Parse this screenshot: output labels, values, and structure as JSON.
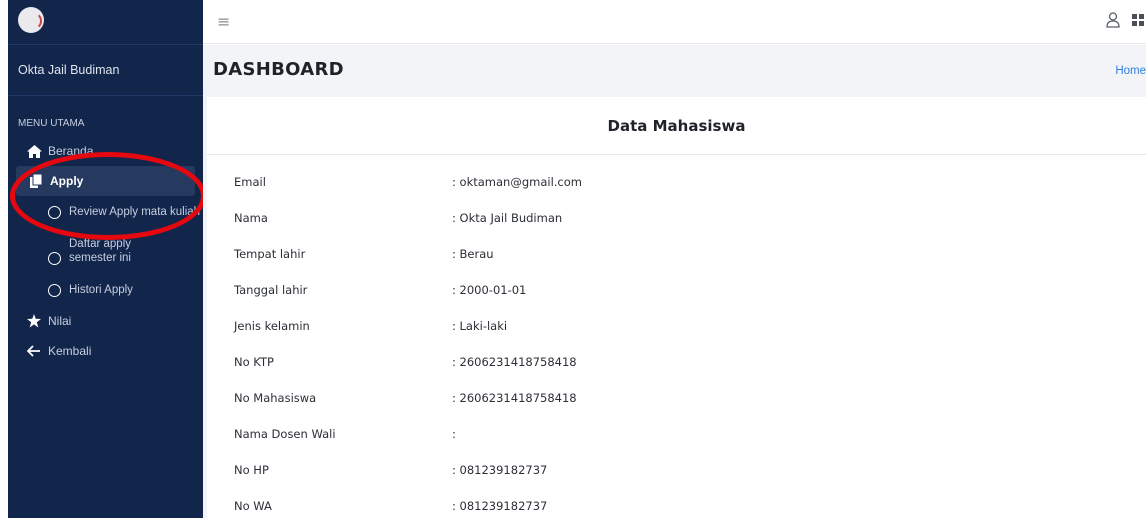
{
  "sidebar": {
    "brand": "",
    "user_name": "Okta Jail Budiman",
    "menu_header": "MENU UTAMA",
    "items": [
      {
        "label": "Beranda",
        "icon": "home-icon"
      },
      {
        "label": "Apply",
        "icon": "copy-icon",
        "active": true
      },
      {
        "label": "Nilai",
        "icon": "star-icon"
      },
      {
        "label": "Kembali",
        "icon": "arrow-left-icon"
      }
    ],
    "sub_items": {
      "review": "Review Apply mata kuliah",
      "daftar_line1": "Daftar apply",
      "daftar_line2": "semester ini",
      "histori": "Histori Apply"
    }
  },
  "topbar": {
    "menu_icon": "hamburger-icon",
    "user_icon": "user-icon",
    "apps_icon": "apps-grid-icon"
  },
  "header": {
    "title": "DASHBOARD",
    "breadcrumb": "Home"
  },
  "card": {
    "title": "Data Mahasiswa",
    "rows": [
      {
        "label": "Email",
        "value": ": oktaman@gmail.com"
      },
      {
        "label": "Nama",
        "value": ": Okta Jail Budiman"
      },
      {
        "label": "Tempat lahir",
        "value": ": Berau"
      },
      {
        "label": "Tanggal lahir",
        "value": ": 2000-01-01"
      },
      {
        "label": "Jenis kelamin",
        "value": ": Laki-laki"
      },
      {
        "label": "No KTP",
        "value": ": 2606231418758418"
      },
      {
        "label": "No Mahasiswa",
        "value": ": 2606231418758418"
      },
      {
        "label": "Nama Dosen Wali",
        "value": ":"
      },
      {
        "label": "No HP",
        "value": ": 081239182737"
      },
      {
        "label": "No WA",
        "value": ": 081239182737"
      }
    ]
  },
  "colors": {
    "sidebar_bg": "#12254a",
    "active_bg": "#263a5f",
    "highlight": "#e5080f",
    "link": "#2f7fe0"
  }
}
